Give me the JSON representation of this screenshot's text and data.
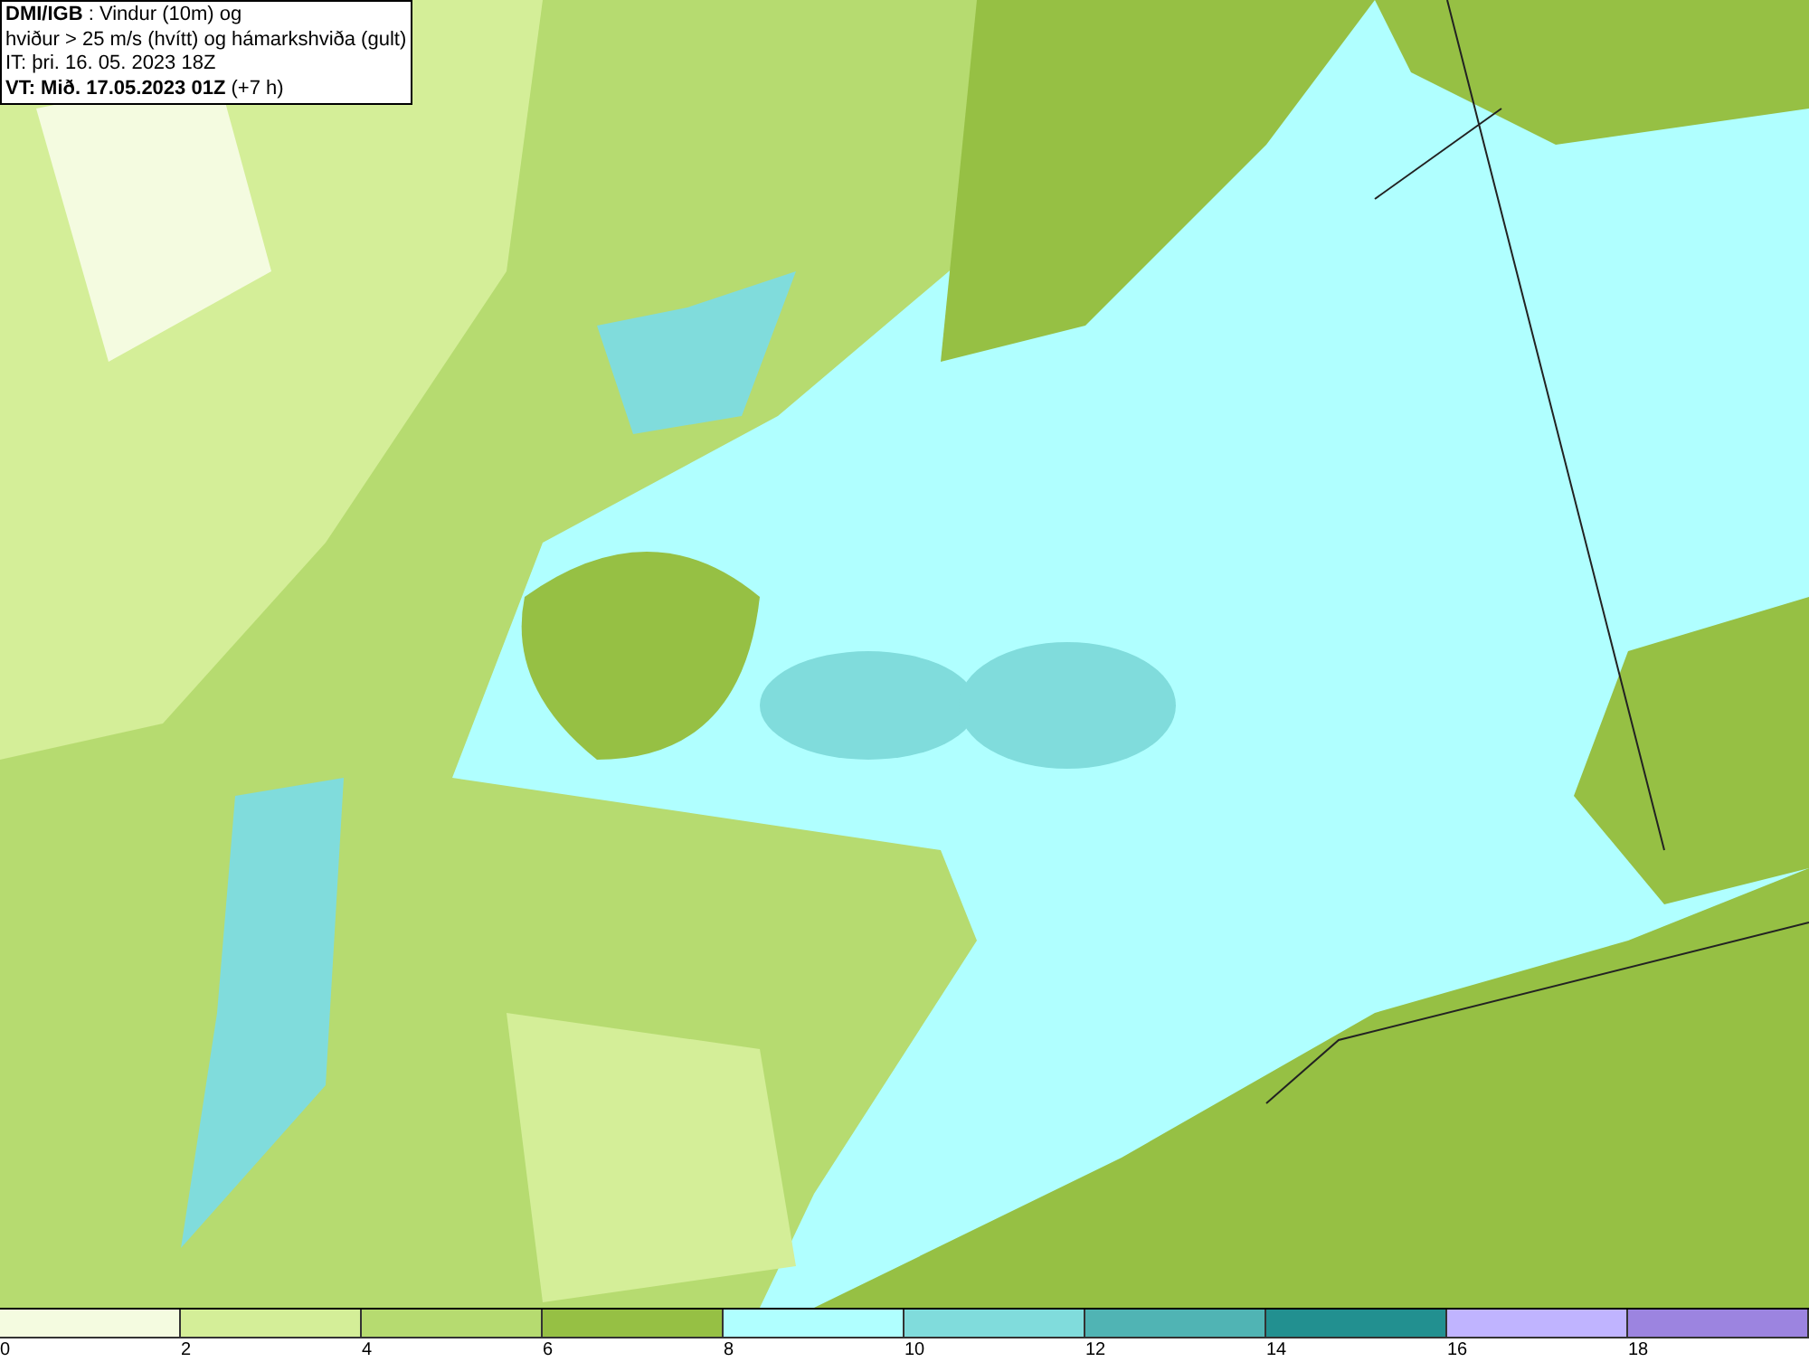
{
  "info_box": {
    "lines": [
      "**DMI/IGB** : Vindur (10m) og",
      "hviður > 25 m/s (hvítt) og hámarkshviða (gult)",
      "IT: þri. 16. 05. 2023 18Z",
      "**VT: Mið. 17.05.2023 01Z** (+7 h)"
    ]
  },
  "colorbar": [
    {
      "label": "0",
      "color": "#f4fbe0"
    },
    {
      "label": "2",
      "color": "#d4ee98"
    },
    {
      "label": "4",
      "color": "#b6db70"
    },
    {
      "label": "6",
      "color": "#96c044"
    },
    {
      "label": "8",
      "color": "#b0ffff"
    },
    {
      "label": "10",
      "color": "#80dcdc"
    },
    {
      "label": "12",
      "color": "#50b4b4"
    },
    {
      "label": "14",
      "color": "#229090"
    },
    {
      "label": "16",
      "color": "#c0b4ff"
    },
    {
      "label": "18",
      "color": "#9c84e0"
    }
  ]
}
